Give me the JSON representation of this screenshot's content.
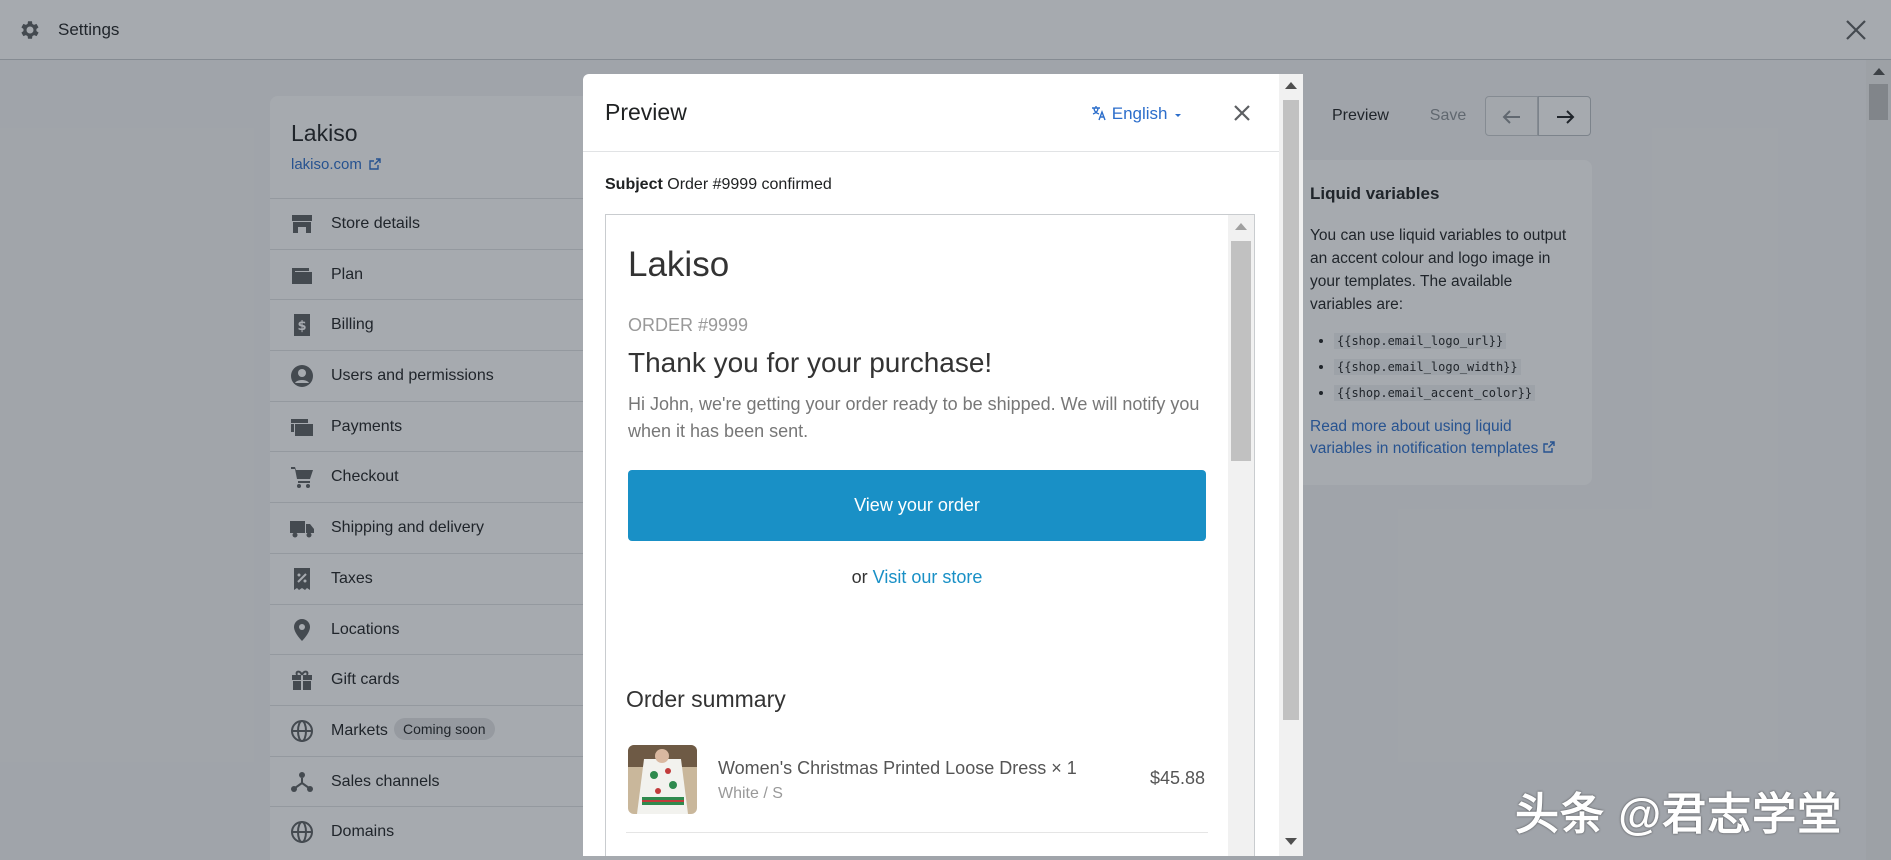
{
  "topbar": {
    "title": "Settings"
  },
  "store": {
    "name": "Lakiso",
    "link": "lakiso.com"
  },
  "nav": {
    "items": [
      {
        "label": "Store details",
        "icon": "store-icon"
      },
      {
        "label": "Plan",
        "icon": "wallet-icon"
      },
      {
        "label": "Billing",
        "icon": "billing-icon"
      },
      {
        "label": "Users and permissions",
        "icon": "user-icon"
      },
      {
        "label": "Payments",
        "icon": "payments-icon"
      },
      {
        "label": "Checkout",
        "icon": "cart-icon"
      },
      {
        "label": "Shipping and delivery",
        "icon": "truck-icon"
      },
      {
        "label": "Taxes",
        "icon": "taxes-icon"
      },
      {
        "label": "Locations",
        "icon": "location-icon"
      },
      {
        "label": "Gift cards",
        "icon": "gift-icon"
      },
      {
        "label": "Markets",
        "icon": "globe-icon",
        "badge": "Coming soon"
      },
      {
        "label": "Sales channels",
        "icon": "channels-icon"
      },
      {
        "label": "Domains",
        "icon": "globe-icon"
      }
    ]
  },
  "toolbar": {
    "preview_label": "Preview",
    "save_label": "Save"
  },
  "liquid": {
    "title": "Liquid variables",
    "intro": "You can use liquid variables to output an accent colour and logo image in your templates. The available variables are:",
    "variables": [
      "{{shop.email_logo_url}}",
      "{{shop.email_logo_width}}",
      "{{shop.email_accent_color}}"
    ],
    "link": "Read more about using liquid variables in notification templates"
  },
  "modal": {
    "title": "Preview",
    "language": "English",
    "subject_label": "Subject",
    "subject_value": "Order #9999 confirmed"
  },
  "email": {
    "store_name": "Lakiso",
    "order_number": "ORDER #9999",
    "heading": "Thank you for your purchase!",
    "body": "Hi John, we're getting your order ready to be shipped. We will notify you when it has been sent.",
    "button": "View your order",
    "or_text": "or",
    "store_link": "Visit our store",
    "summary_title": "Order summary",
    "item": {
      "name": "Women's Christmas Printed Loose Dress × 1",
      "variant": "White / S",
      "price": "$45.88"
    },
    "accent_color": "#1990c6"
  },
  "watermark": "头条 @君志学堂"
}
